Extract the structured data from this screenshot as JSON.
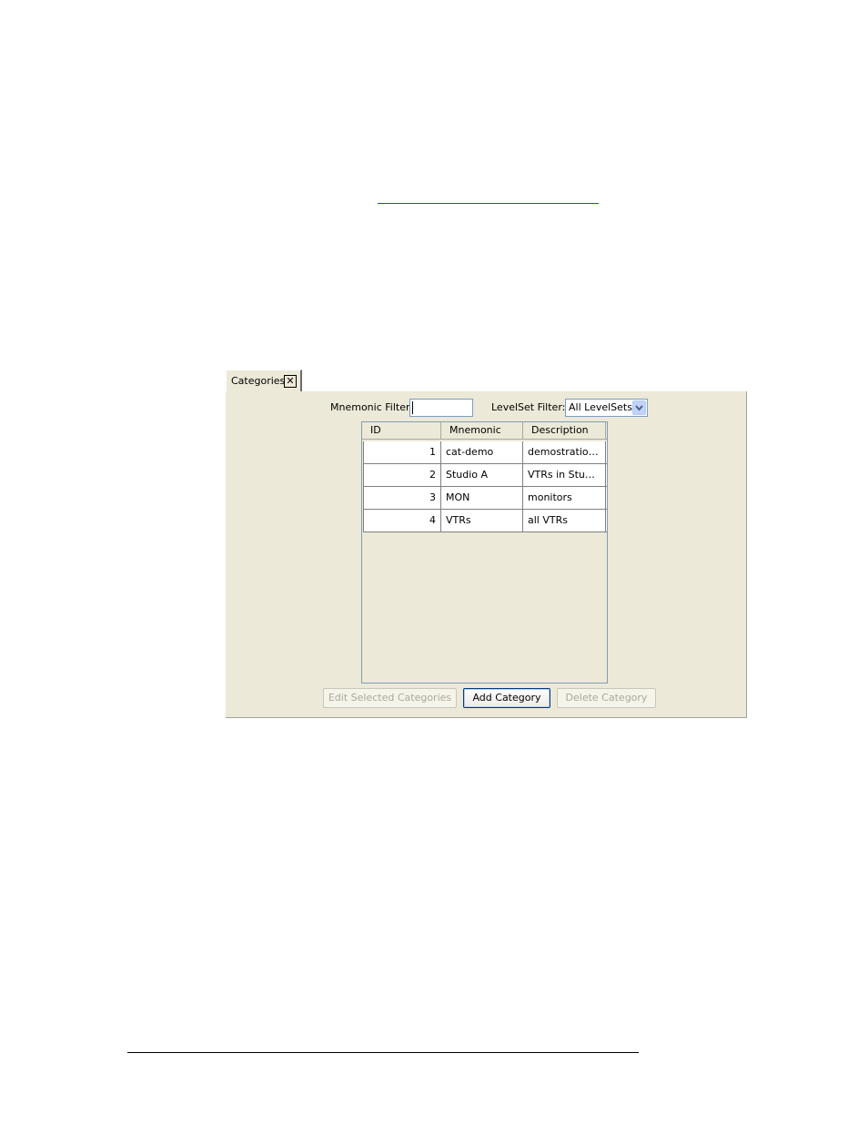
{
  "tab": {
    "label": "Categories",
    "close_glyph": "✕"
  },
  "filters": {
    "mnemonic_label": "Mnemonic Filter:",
    "mnemonic_value": "",
    "levelset_label": "LevelSet Filter:",
    "levelset_value": "All LevelSets"
  },
  "table": {
    "headers": [
      "ID",
      "Mnemonic",
      "Description"
    ],
    "rows": [
      {
        "id": "1",
        "mnemonic": "cat-demo",
        "description": "demostration ..."
      },
      {
        "id": "2",
        "mnemonic": "Studio A",
        "description": "VTRs in Studio A"
      },
      {
        "id": "3",
        "mnemonic": "MON",
        "description": "monitors"
      },
      {
        "id": "4",
        "mnemonic": "VTRs",
        "description": "all VTRs"
      }
    ]
  },
  "buttons": {
    "edit_label": "Edit Selected Categories",
    "add_label": "Add Category",
    "delete_label": "Delete Category"
  },
  "icons": {
    "close": "close-icon",
    "dropdown": "chevron-down-icon"
  },
  "colors": {
    "panel_bg": "#ece9d8",
    "accent_border": "#003c74",
    "dropdown_bg": "#c1d3fb",
    "disabled_text": "#aca899"
  }
}
